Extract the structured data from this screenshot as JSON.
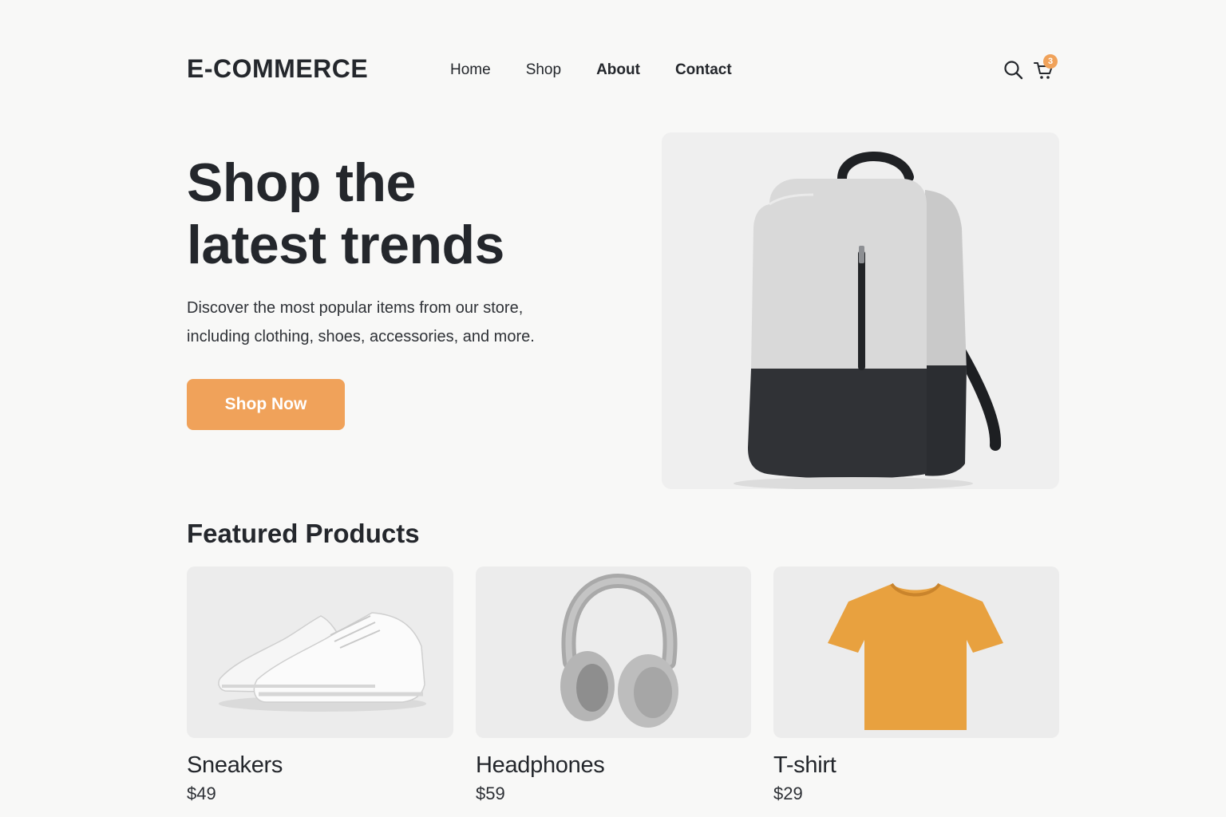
{
  "brand": {
    "logo": "E-COMMERCE"
  },
  "nav": {
    "home": "Home",
    "shop": "Shop",
    "about": "About",
    "contact": "Contact"
  },
  "header": {
    "search_icon": "search-icon",
    "cart_icon": "cart-icon",
    "cart_count": "3"
  },
  "hero": {
    "title_line1": "Shop the",
    "title_line2": "latest trends",
    "subtitle_line1": "Discover the most popular items from our store,",
    "subtitle_line2": "including clothing, shoes, accessories, and more.",
    "cta_label": "Shop Now",
    "image": "backpack"
  },
  "featured": {
    "title": "Featured Products",
    "products": [
      {
        "name": "Sneakers",
        "price": "$49",
        "image": "sneakers"
      },
      {
        "name": "Headphones",
        "price": "$59",
        "image": "headphones"
      },
      {
        "name": "T-shirt",
        "price": "$29",
        "image": "t-shirt"
      }
    ]
  },
  "colors": {
    "accent": "#f0a25a",
    "badge": "#f0a25a",
    "text": "#24272c",
    "tshirt": "#e8a13f"
  }
}
